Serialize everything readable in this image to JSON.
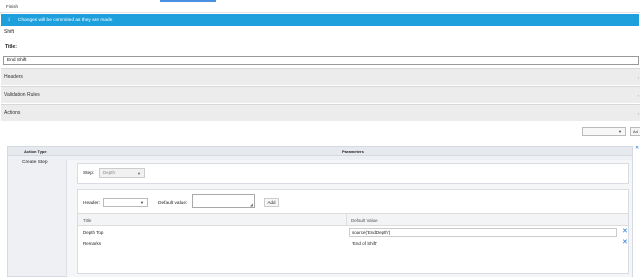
{
  "toolbar": {
    "finish_label": "Finish"
  },
  "info": {
    "icon": "info-icon",
    "message": "Changes will be commited as they are made"
  },
  "shift_label": "Shift",
  "title": {
    "label": "Title:",
    "value": "End Shift"
  },
  "sections": {
    "headers": "Headers",
    "validation_rules": "Validation Rules",
    "actions": "Actions"
  },
  "add_action": {
    "selected": "",
    "button_label": "Ad"
  },
  "grid": {
    "col_action_type": "Action Type",
    "col_parameters": "Parameters",
    "action_type": "Create Step",
    "step": {
      "label": "Step:",
      "selected": "Depth"
    },
    "header": {
      "label": "Header:",
      "selected": ""
    },
    "default_value": {
      "label": "Default value:",
      "value": ""
    },
    "add_label": "Add",
    "table": {
      "columns": [
        "Title",
        "Default Value"
      ],
      "rows": [
        {
          "title": "Depth Top",
          "value": "source('EndDepth')"
        },
        {
          "title": "Remarks",
          "value": "'End of Shift'"
        }
      ]
    }
  },
  "colors": {
    "info_bar": "#1ea0dc",
    "delete_icon": "#1976d2"
  }
}
